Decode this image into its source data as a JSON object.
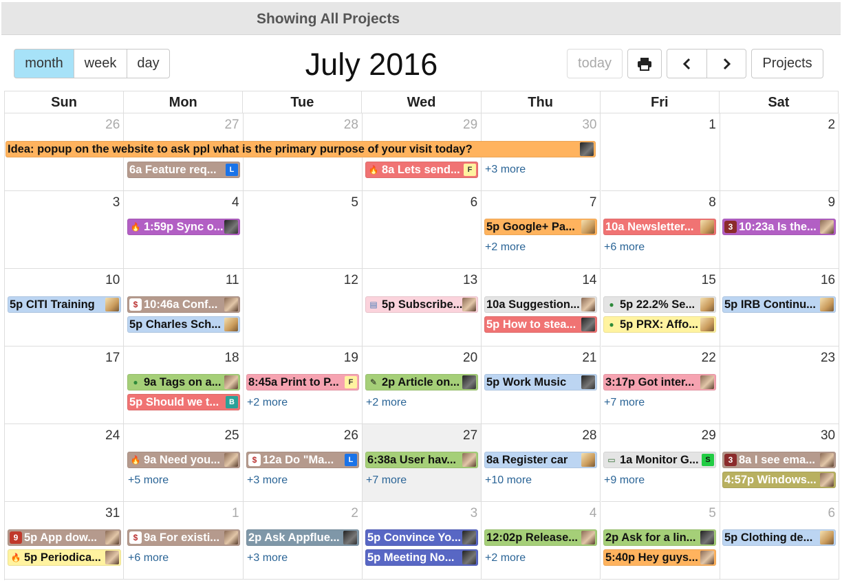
{
  "header": {
    "banner": "Showing All Projects",
    "title": "July 2016"
  },
  "toolbar": {
    "month": "month",
    "week": "week",
    "day": "day",
    "today": "today",
    "prev": "‹",
    "next": "›",
    "projects": "Projects"
  },
  "days_of_week": [
    "Sun",
    "Mon",
    "Tue",
    "Wed",
    "Thu",
    "Fri",
    "Sat"
  ],
  "weeks": [
    [
      "26",
      "27",
      "28",
      "29",
      "30",
      "1",
      "2"
    ],
    [
      "3",
      "4",
      "5",
      "6",
      "7",
      "8",
      "9"
    ],
    [
      "10",
      "11",
      "12",
      "13",
      "14",
      "15",
      "16"
    ],
    [
      "17",
      "18",
      "19",
      "20",
      "21",
      "22",
      "23"
    ],
    [
      "24",
      "25",
      "26",
      "27",
      "28",
      "29",
      "30"
    ],
    [
      "31",
      "1",
      "2",
      "3",
      "4",
      "5",
      "6"
    ]
  ],
  "events": {
    "w0_span": "Idea: popup on the website to ask ppl what is the primary purpose of your visit today?",
    "w0_mon": "6a Feature req...",
    "w0_wed": "8a Lets send...",
    "w1_mon": "1:59p Sync o...",
    "w1_thu": "5p Google+ Pa...",
    "w1_fri": "10a Newsletter...",
    "w1_sat": "10:23a Is the...",
    "w2_sun": "5p CITI Training",
    "w2_mon1": "10:46a Conf...",
    "w2_mon2": "5p Charles Sch...",
    "w2_wed": "5p Subscribe...",
    "w2_thu1": "10a Suggestion...",
    "w2_thu2": "5p How to stea...",
    "w2_fri1": "5p 22.2% Se...",
    "w2_fri2": "5p PRX: Affo...",
    "w2_sat": "5p IRB Continu...",
    "w3_mon1": "9a Tags on a...",
    "w3_mon2": "5p Should we t...",
    "w3_tue": "8:45a Print to P...",
    "w3_wed": "2p Article on...",
    "w3_thu": "5p Work Music",
    "w3_fri": "3:17p Got inter...",
    "w4_mon": "9a Need you...",
    "w4_tue": "12a Do \"Ma...",
    "w4_wed": "6:38a User hav...",
    "w4_thu": "8a Register car",
    "w4_fri": "1a Monitor G...",
    "w4_sat1": "8a I see ema...",
    "w4_sat2": "4:57p Windows...",
    "w5_sun1": "5p App dow...",
    "w5_sun2": "5p Periodica...",
    "w5_mon": "9a For existi...",
    "w5_tue": "2p Ask Appflue...",
    "w5_wed1": "5p Convince Yo...",
    "w5_wed2": "5p Meeting No...",
    "w5_thu": "12:02p Release...",
    "w5_fri1": "2p Ask for a lin...",
    "w5_fri2": "5:40p Hey guys...",
    "w5_sat": "5p Clothing de..."
  },
  "tags": {
    "L": "L",
    "F": "F",
    "B": "B",
    "S": "S",
    "dollar": "$",
    "three": "3",
    "nine": "9"
  },
  "more": {
    "w0_thu": "+3 more",
    "w1_thu": "+2 more",
    "w1_fri": "+6 more",
    "w3_tue": "+2 more",
    "w3_wed": "+2 more",
    "w3_fri": "+7 more",
    "w4_mon": "+5 more",
    "w4_tue": "+3 more",
    "w4_wed": "+7 more",
    "w4_thu": "+10 more",
    "w4_fri": "+9 more",
    "w5_mon": "+6 more",
    "w5_tue": "+3 more",
    "w5_thu": "+2 more"
  },
  "colors": {
    "orange": "#ffb35e",
    "taupe": "#b59a8d",
    "pink": "#f6a3b1",
    "purple": "#b25fc4",
    "red": "#f07373",
    "blue": "#bcd5f2",
    "gray": "#e4e4e4",
    "yellow": "#fff3a0",
    "green": "#a5cf78",
    "slate": "#7f97a8",
    "indigo": "#5867c4",
    "olive": "#b8b060"
  }
}
